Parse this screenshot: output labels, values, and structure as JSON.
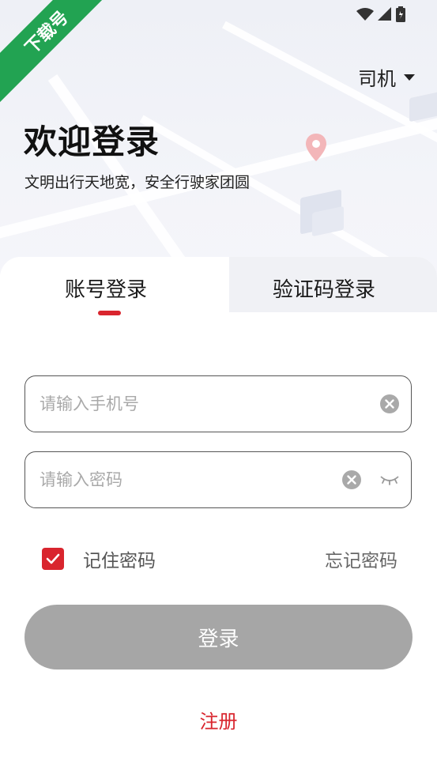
{
  "watermark": "下载号",
  "role_selector": {
    "label": "司机"
  },
  "welcome": {
    "title": "欢迎登录",
    "subtitle": "文明出行天地宽，安全行驶家团圆"
  },
  "tabs": [
    {
      "label": "账号登录",
      "active": true
    },
    {
      "label": "验证码登录",
      "active": false
    }
  ],
  "phone": {
    "placeholder": "请输入手机号",
    "value": ""
  },
  "password": {
    "placeholder": "请输入密码",
    "value": ""
  },
  "remember": {
    "label": "记住密码",
    "checked": true
  },
  "forgot_label": "忘记密码",
  "login_label": "登录",
  "register_label": "注册",
  "colors": {
    "accent": "#d9252e",
    "button_disabled": "#a6a6a6",
    "watermark": "#22a352"
  },
  "icons": [
    "wifi-icon",
    "signal-icon",
    "battery-icon",
    "caret-down-icon",
    "map-pin-icon",
    "clear-icon",
    "eye-closed-icon",
    "checkmark-icon"
  ]
}
